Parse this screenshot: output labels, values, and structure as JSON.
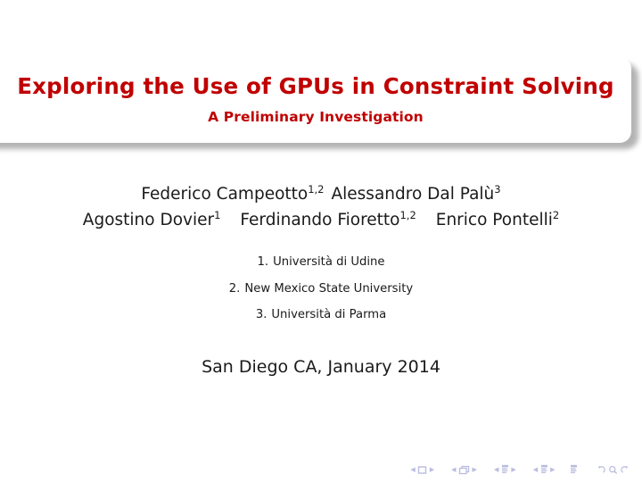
{
  "slide": {
    "title": "Exploring the Use of GPUs in Constraint Solving",
    "subtitle": "A Preliminary Investigation",
    "title_color": "#c00000",
    "authors": [
      {
        "line_index": 1,
        "names": [
          {
            "name": "Federico Campeotto",
            "affiliation": "1,2"
          },
          {
            "name": "Alessandro Dal Palù",
            "affiliation": "3"
          }
        ]
      },
      {
        "line_index": 2,
        "names": [
          {
            "name": "Agostino Dovier",
            "affiliation": "1"
          },
          {
            "name": "Ferdinando Fioretto",
            "affiliation": "1,2"
          },
          {
            "name": "Enrico Pontelli",
            "affiliation": "2"
          }
        ]
      }
    ],
    "institutes": [
      {
        "number": "1.",
        "name": "Università di Udine"
      },
      {
        "number": "2.",
        "name": "New Mexico State University"
      },
      {
        "number": "3.",
        "name": "Università di Parma"
      }
    ],
    "date": "San Diego CA, January 2014"
  },
  "navigation": {
    "color": "#b9bcdf",
    "left_arrow": "◀",
    "right_arrow": "▶",
    "groups": [
      {
        "icon": "slide-icon",
        "label": "slide"
      },
      {
        "icon": "frame-icon",
        "label": "frame"
      },
      {
        "icon": "subsection-icon",
        "label": "subsection"
      },
      {
        "icon": "section-icon",
        "label": "section"
      }
    ],
    "doc_icon": "document-icon",
    "back_icon": "go-back-icon",
    "search_icon": "search-icon",
    "forward_icon": "go-forward-icon"
  }
}
